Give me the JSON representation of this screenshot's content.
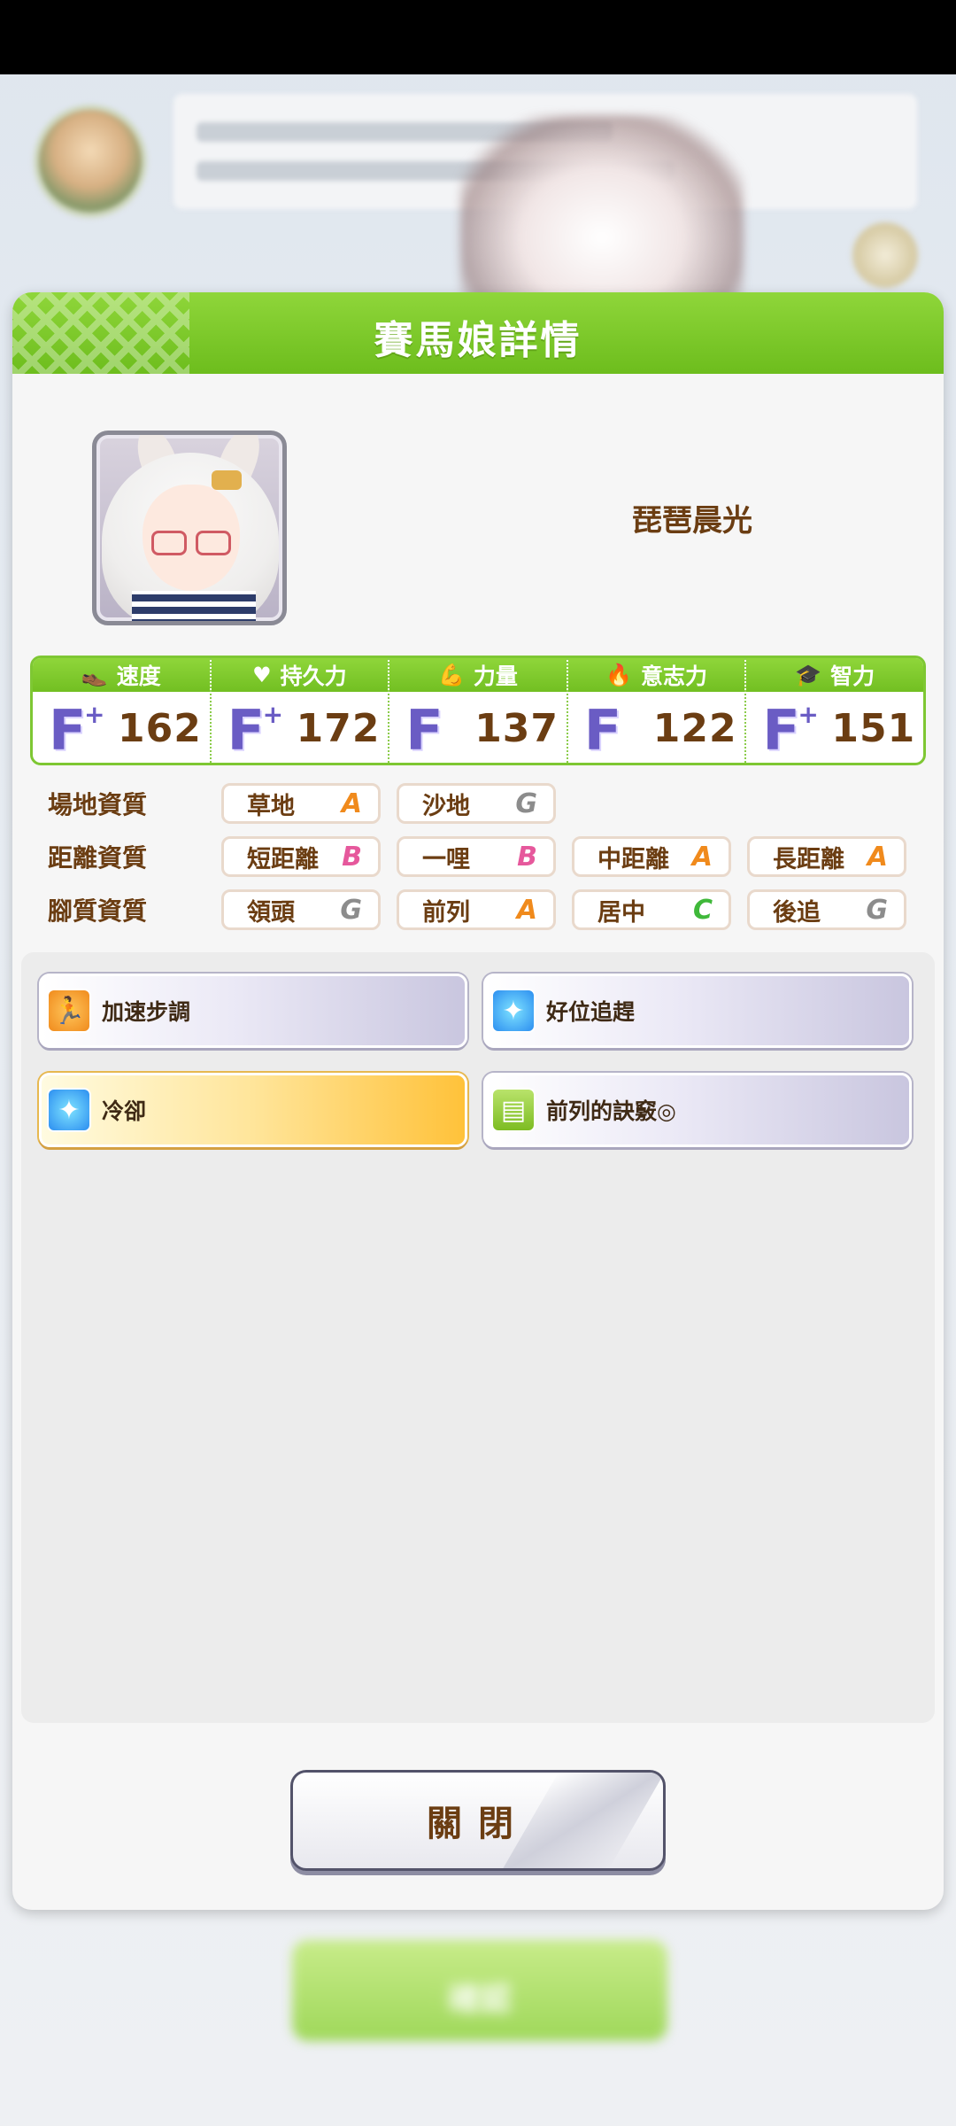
{
  "background": {
    "next_button_label": "確認"
  },
  "dialog": {
    "title": "賽馬娘詳情",
    "character_name": "琵琶晨光",
    "stats": [
      {
        "label": "速度",
        "icon": "shoe-icon",
        "grade": "F",
        "plus": "+",
        "value": "162"
      },
      {
        "label": "持久力",
        "icon": "heart-icon",
        "grade": "F",
        "plus": "+",
        "value": "172"
      },
      {
        "label": "力量",
        "icon": "muscle-icon",
        "grade": "F",
        "plus": "",
        "value": "137"
      },
      {
        "label": "意志力",
        "icon": "flame-icon",
        "grade": "F",
        "plus": "",
        "value": "122"
      },
      {
        "label": "智力",
        "icon": "graduation-cap-icon",
        "grade": "F",
        "plus": "+",
        "value": "151"
      }
    ],
    "aptitudes": {
      "track": {
        "label": "場地資質",
        "items": [
          {
            "name": "草地",
            "rank": "A"
          },
          {
            "name": "沙地",
            "rank": "G"
          }
        ]
      },
      "distance": {
        "label": "距離資質",
        "items": [
          {
            "name": "短距離",
            "rank": "B"
          },
          {
            "name": "一哩",
            "rank": "B"
          },
          {
            "name": "中距離",
            "rank": "A"
          },
          {
            "name": "長距離",
            "rank": "A"
          }
        ]
      },
      "style": {
        "label": "腳質資質",
        "items": [
          {
            "name": "領頭",
            "rank": "G"
          },
          {
            "name": "前列",
            "rank": "A"
          },
          {
            "name": "居中",
            "rank": "C"
          },
          {
            "name": "後追",
            "rank": "G"
          }
        ]
      }
    },
    "rank_colors": {
      "A": "#f08a1c",
      "B": "#e6589c",
      "C": "#3fb83a",
      "G": "#8c8c8c"
    },
    "skills": [
      {
        "label": "加速步調",
        "icon": "runner-icon",
        "rarity": "normal"
      },
      {
        "label": "好位追趕",
        "icon": "sparkle-icon",
        "rarity": "normal"
      },
      {
        "label": "冷卻",
        "icon": "sparkle-icon",
        "rarity": "gold"
      },
      {
        "label": "前列的訣竅◎",
        "icon": "book-icon",
        "rarity": "normal"
      }
    ],
    "close_label": "關閉"
  }
}
